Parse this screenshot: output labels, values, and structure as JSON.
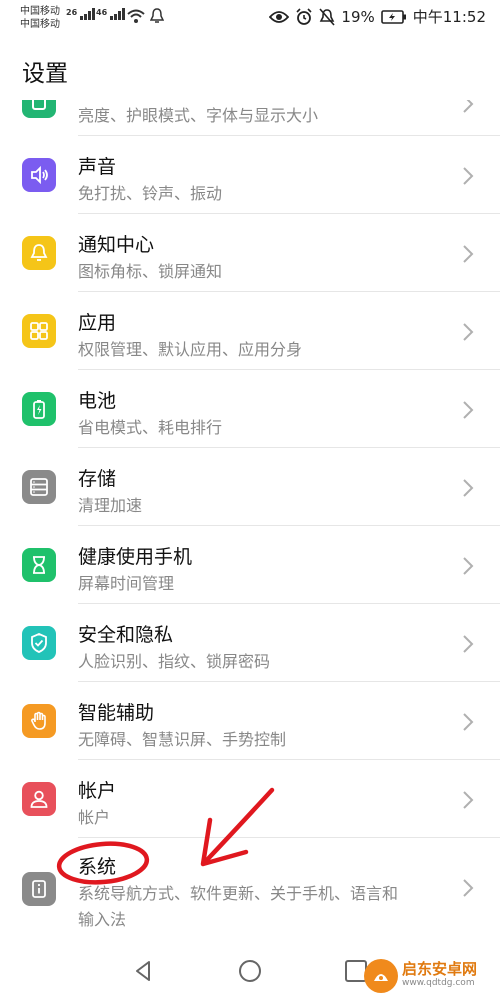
{
  "status_bar": {
    "carrier_1": "中国移动",
    "carrier_2": "中国移动",
    "net_1": "26",
    "net_2": "46",
    "battery": "19%",
    "time": "中午11:52"
  },
  "header": {
    "title": "设置"
  },
  "partial_item": {
    "subtitle": "亮度、护眼模式、字体与显示大小",
    "icon": "display-icon",
    "color": "#22b573"
  },
  "items": [
    {
      "title": "声音",
      "subtitle": "免打扰、铃声、振动",
      "icon": "sound-icon",
      "color": "#7b5cf0"
    },
    {
      "title": "通知中心",
      "subtitle": "图标角标、锁屏通知",
      "icon": "bell-icon",
      "color": "#f5c518"
    },
    {
      "title": "应用",
      "subtitle": "权限管理、默认应用、应用分身",
      "icon": "apps-icon",
      "color": "#f5c518"
    },
    {
      "title": "电池",
      "subtitle": "省电模式、耗电排行",
      "icon": "battery-icon",
      "color": "#1fc16b"
    },
    {
      "title": "存储",
      "subtitle": "清理加速",
      "icon": "storage-icon",
      "color": "#8a8a8a"
    },
    {
      "title": "健康使用手机",
      "subtitle": "屏幕时间管理",
      "icon": "hourglass-icon",
      "color": "#1fc16b"
    },
    {
      "title": "安全和隐私",
      "subtitle": "人脸识别、指纹、锁屏密码",
      "icon": "shield-icon",
      "color": "#22c3b8"
    },
    {
      "title": "智能辅助",
      "subtitle": "无障碍、智慧识屏、手势控制",
      "icon": "hand-icon",
      "color": "#f59a23"
    },
    {
      "title": "帐户",
      "subtitle": "帐户",
      "icon": "account-icon",
      "color": "#e8505b"
    },
    {
      "title": "系统",
      "subtitle": "系统导航方式、软件更新、关于手机、语言和",
      "subtitle_2": "输入法",
      "icon": "info-icon",
      "color": "#8a8a8a"
    }
  ],
  "watermark": {
    "name": "启东安卓网",
    "url": "www.qdtdg.com"
  }
}
